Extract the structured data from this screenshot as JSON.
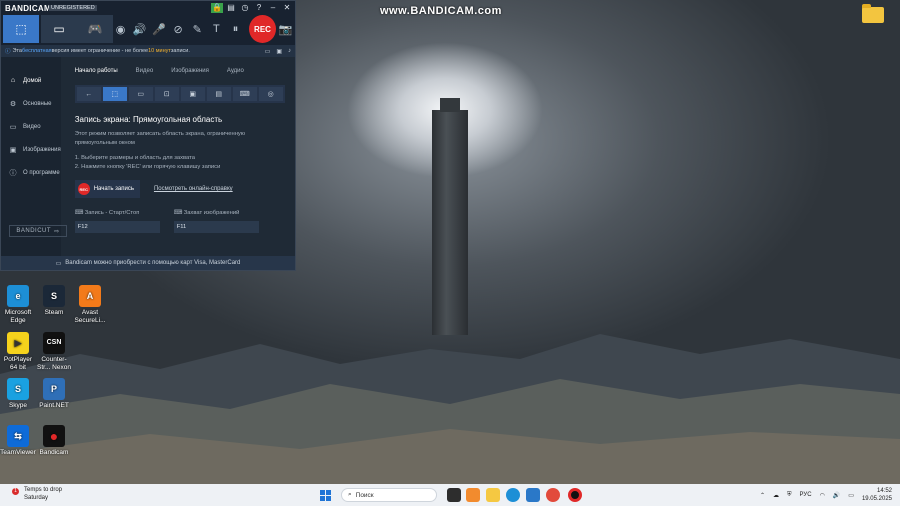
{
  "watermark": "www.BANDICAM.com",
  "bandicam": {
    "logo": "BANDICAM",
    "unregistered": "UNREGISTERED",
    "rec_label": "REC",
    "notice": {
      "part1": "Эта ",
      "free": "бесплатная",
      "part2": " версия имеет ограничение - не более ",
      "minutes": "10 минут",
      "part3": " записи."
    },
    "sidebar": [
      {
        "label": "Домой",
        "icon": "home-icon"
      },
      {
        "label": "Основные",
        "icon": "gear-icon"
      },
      {
        "label": "Видео",
        "icon": "video-icon"
      },
      {
        "label": "Изображения",
        "icon": "image-icon"
      },
      {
        "label": "О программе",
        "icon": "info-icon"
      }
    ],
    "bandicut": "BANDICUT",
    "tabs": [
      "Начало работы",
      "Видео",
      "Изображения",
      "Аудио"
    ],
    "mode_title": "Запись экрана: Прямоугольная область",
    "mode_desc": "Этот режим позволяет записать область экрана, ограниченную прямоугольным окном",
    "steps": [
      "1. Выберите размеры и область для захвата",
      "2. Нажмите кнопку 'REC' или горячую клавишу записи"
    ],
    "start_button": "Начать запись",
    "start_dot": "REC",
    "help_link": "Посмотреть онлайн-справку",
    "hotkeys": [
      {
        "label": "Запись - Старт/Стоп",
        "value": "F12"
      },
      {
        "label": "Захват изображений",
        "value": "F11"
      }
    ],
    "ad": "Bandicam можно приобрести с помощью карт Visa, MasterCard"
  },
  "desktop_icons": [
    {
      "label": "Microsoft Edge",
      "color": "#1d8fd6",
      "glyph": "e"
    },
    {
      "label": "Steam",
      "color": "#1b2838",
      "glyph": "S"
    },
    {
      "label": "Avast SecureLi...",
      "color": "#f27a1a",
      "glyph": "A"
    },
    {
      "label": "PotPlayer 64 bit",
      "color": "#f5d21c",
      "glyph": "▶"
    },
    {
      "label": "Counter-Str... Nexon",
      "color": "#111111",
      "glyph": "CSN"
    },
    {
      "label": "Skype",
      "color": "#1aa1e1",
      "glyph": "S"
    },
    {
      "label": "Paint.NET",
      "color": "#2f6fb7",
      "glyph": "P"
    },
    {
      "label": "TeamViewer",
      "color": "#0e6bd8",
      "glyph": "⇆"
    },
    {
      "label": "Bandicam",
      "color": "#111111",
      "glyph": "●"
    }
  ],
  "taskbar": {
    "weather_line1": "Temps to drop",
    "weather_line2": "Saturday",
    "badge": "1",
    "search_placeholder": "Поиск",
    "lang": "РУС",
    "time": "14:52",
    "date": "19.05.2025"
  }
}
